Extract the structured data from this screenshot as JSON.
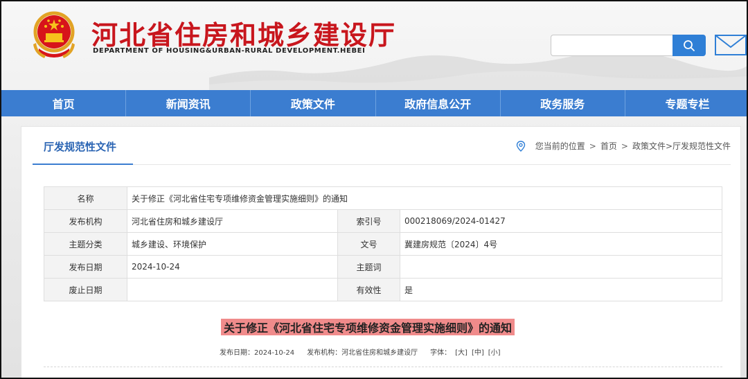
{
  "header": {
    "title": "河北省住房和城乡建设厅",
    "subtitle": "DEPARTMENT OF HOUSING&URBAN-RURAL DEVELOPMENT.HEBEI",
    "search": {
      "value": "",
      "placeholder": ""
    },
    "icons": [
      "national-emblem-icon",
      "search-icon",
      "mail-icon"
    ],
    "colors": {
      "title": "#c8161d",
      "nav": "#3b7dd0",
      "search_button": "#2f7fd6"
    }
  },
  "nav": {
    "items": [
      {
        "label": "首页"
      },
      {
        "label": "新闻资讯"
      },
      {
        "label": "政策文件"
      },
      {
        "label": "政府信息公开"
      },
      {
        "label": "政务服务"
      },
      {
        "label": "专题专栏"
      }
    ]
  },
  "section": {
    "title": "厅发规范性文件",
    "breadcrumb": {
      "prefix": "您当前的位置",
      "sep": ">",
      "home": "首页",
      "path": "政策文件>厅发规范性文件"
    }
  },
  "meta": {
    "name_label": "名称",
    "name_value": "关于修正《河北省住宅专项维修资金管理实施细则》的通知",
    "rows": [
      {
        "l1": "发布机构",
        "v1": "河北省住房和城乡建设厅",
        "l2": "索引号",
        "v2": "000218069/2024-01427"
      },
      {
        "l1": "主题分类",
        "v1": "城乡建设、环境保护",
        "l2": "文号",
        "v2": "冀建房规范〔2024〕4号"
      },
      {
        "l1": "发布日期",
        "v1": "2024-10-24",
        "l2": "主题词",
        "v2": ""
      },
      {
        "l1": "废止日期",
        "v1": "",
        "l2": "有效性",
        "v2": "是"
      }
    ]
  },
  "document": {
    "title": "关于修正《河北省住宅专项维修资金管理实施细则》的通知",
    "highlight_color": "#f08b8b",
    "publish_date": "发布日期：2024-10-24",
    "publisher": "发布机构：河北省住房和城乡建设厅",
    "font_size_label": "字体：",
    "font_large": "[大]",
    "font_medium": "[中]",
    "font_small": "[小]"
  }
}
